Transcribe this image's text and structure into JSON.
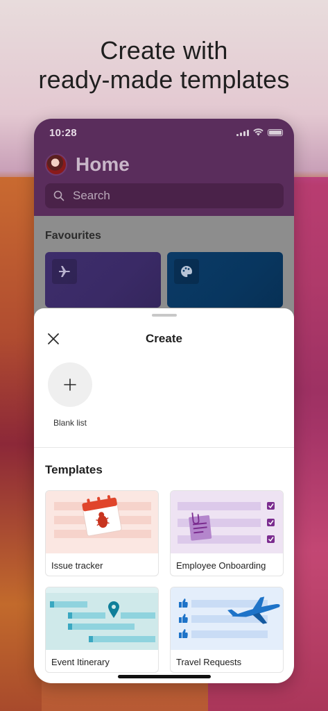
{
  "hero": {
    "line1": "Create with",
    "line2": "ready-made templates"
  },
  "status_bar": {
    "time": "10:28"
  },
  "header": {
    "title": "Home",
    "search_placeholder": "Search"
  },
  "favourites": {
    "title": "Favourites",
    "items": [
      {
        "icon": "airplane-icon"
      },
      {
        "icon": "palette-icon"
      }
    ]
  },
  "create_sheet": {
    "title": "Create",
    "blank_list_label": "Blank list",
    "templates_title": "Templates",
    "templates": [
      {
        "label": "Issue tracker",
        "icon": "calendar-bug-icon"
      },
      {
        "label": "Employee Onboarding",
        "icon": "checklist-icon"
      },
      {
        "label": "Event Itinerary",
        "icon": "map-pin-icon"
      },
      {
        "label": "Travel Requests",
        "icon": "airplane-icon"
      }
    ]
  },
  "colors": {
    "header_bg": "#5a2d5c",
    "accent_purple": "#7b2c8f",
    "accent_blue": "#1e73c8"
  }
}
